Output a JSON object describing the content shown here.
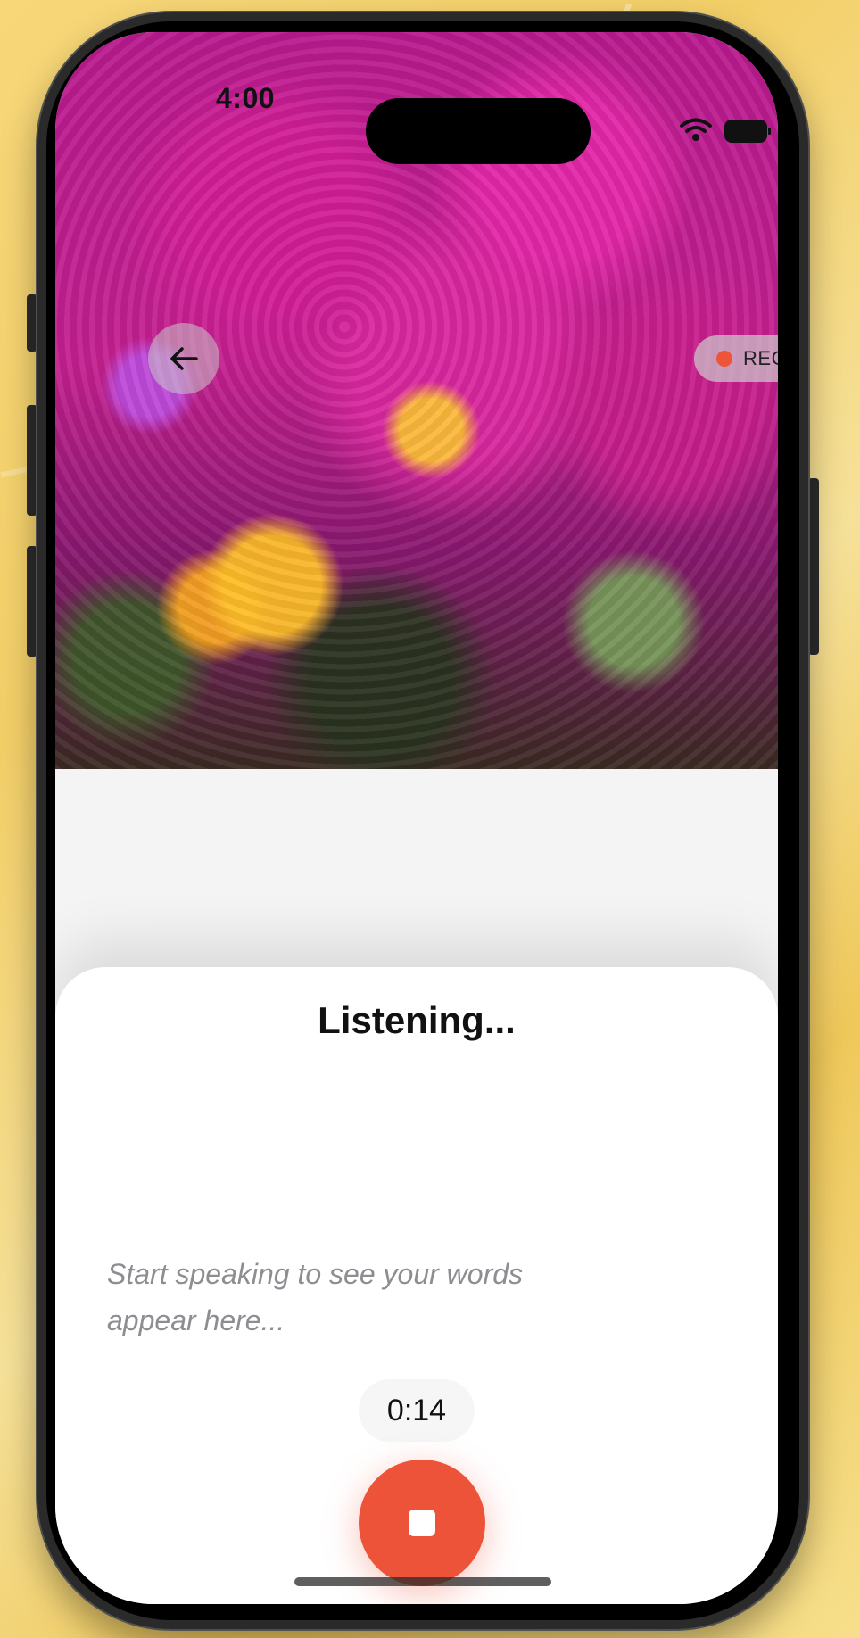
{
  "status_bar": {
    "time": "4:00"
  },
  "header": {
    "rec_label": "REC"
  },
  "sheet": {
    "title": "Listening...",
    "placeholder": "Start speaking to see your words appear here...",
    "timer": "0:14"
  },
  "colors": {
    "accent": "#ec5338",
    "rec_dot": "#ee5538"
  },
  "icons": {
    "back": "arrow-left-icon",
    "stop": "stop-icon",
    "wifi": "wifi-icon",
    "battery": "battery-icon"
  }
}
